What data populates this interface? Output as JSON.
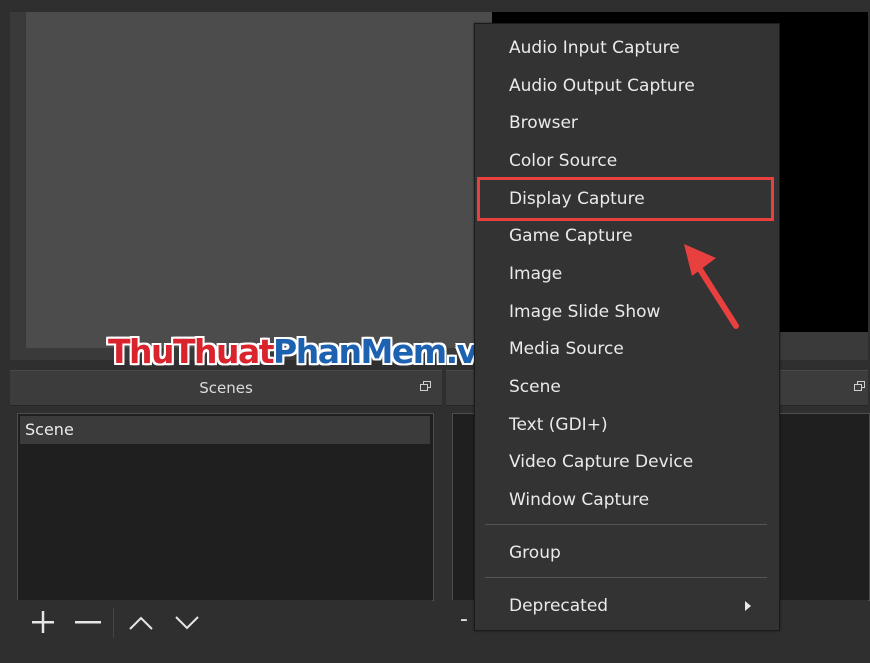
{
  "docks": {
    "scenes_title": "Scenes"
  },
  "scenes": {
    "items": [
      "Scene"
    ]
  },
  "toolbar": {
    "add_glyph": "+",
    "remove_glyph": "−",
    "sources_partial_glyph": "-"
  },
  "watermark": {
    "part1": "ThuThuat",
    "part2": "PhanMem.vn"
  },
  "menu": {
    "items": [
      "Audio Input Capture",
      "Audio Output Capture",
      "Browser",
      "Color Source",
      "Display Capture",
      "Game Capture",
      "Image",
      "Image Slide Show",
      "Media Source",
      "Scene",
      "Text (GDI+)",
      "Video Capture Device",
      "Window Capture"
    ],
    "group": "Group",
    "deprecated": "Deprecated",
    "highlighted_item": "Display Capture"
  },
  "colors": {
    "highlight": "#e8403e",
    "arrow": "#e8403e",
    "watermark_red": "#d9232d",
    "watermark_blue": "#1d62b0"
  },
  "icons": [
    "add-icon",
    "remove-icon",
    "move-up-icon",
    "move-down-icon",
    "dock-float-icon",
    "submenu-arrow-icon"
  ]
}
